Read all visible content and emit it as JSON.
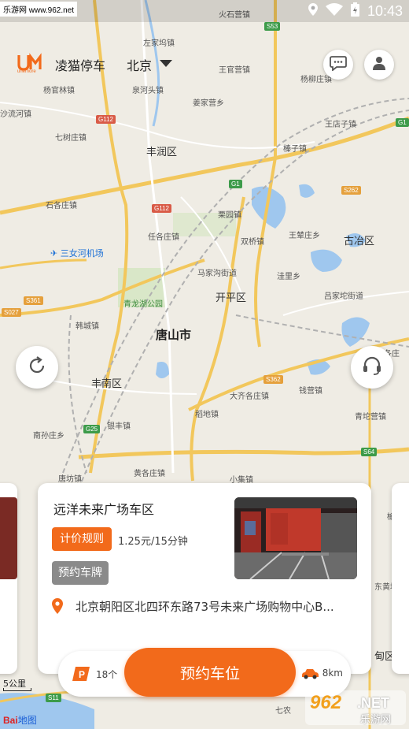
{
  "status_bar": {
    "watermark": "乐游网 www.962.net",
    "time": "10:43"
  },
  "header": {
    "logo_text": "unemore",
    "brand": "凌猫停车",
    "city": "北京"
  },
  "map": {
    "places": [
      {
        "label": "火石营镇",
        "size": "small"
      },
      {
        "label": "左家坞镇",
        "size": "small"
      },
      {
        "label": "王官营镇",
        "size": "small"
      },
      {
        "label": "杨柳庄镇",
        "size": "small"
      },
      {
        "label": "杨官林镇",
        "size": "small"
      },
      {
        "label": "泉河头镇",
        "size": "small"
      },
      {
        "label": "姜家营乡",
        "size": "small"
      },
      {
        "label": "沙流河镇",
        "size": "small"
      },
      {
        "label": "七树庄镇",
        "size": "small"
      },
      {
        "label": "王店子镇",
        "size": "small"
      },
      {
        "label": "丰润区",
        "size": "medium"
      },
      {
        "label": "榛子镇",
        "size": "small"
      },
      {
        "label": "石各庄镇",
        "size": "small"
      },
      {
        "label": "栗园镇",
        "size": "small"
      },
      {
        "label": "任各庄镇",
        "size": "small"
      },
      {
        "label": "王辇庄乡",
        "size": "small"
      },
      {
        "label": "古冶区",
        "size": "medium"
      },
      {
        "label": "双桥镇",
        "size": "small"
      },
      {
        "label": "三女河机场",
        "size": "airport"
      },
      {
        "label": "马家沟街道",
        "size": "small"
      },
      {
        "label": "洼里乡",
        "size": "small"
      },
      {
        "label": "开平区",
        "size": "medium"
      },
      {
        "label": "吕家坨街道",
        "size": "small"
      },
      {
        "label": "青龙湖公园",
        "size": "park"
      },
      {
        "label": "韩城镇",
        "size": "small"
      },
      {
        "label": "唐山市",
        "size": "big"
      },
      {
        "label": "范各庄",
        "size": "small"
      },
      {
        "label": "丰南区",
        "size": "medium"
      },
      {
        "label": "大齐各庄镇",
        "size": "small"
      },
      {
        "label": "钱营镇",
        "size": "small"
      },
      {
        "label": "稻地镇",
        "size": "small"
      },
      {
        "label": "青坨营镇",
        "size": "small"
      },
      {
        "label": "南孙庄乡",
        "size": "small"
      },
      {
        "label": "银丰镇",
        "size": "small"
      },
      {
        "label": "黄各庄镇",
        "size": "small"
      },
      {
        "label": "唐坊镇",
        "size": "small"
      },
      {
        "label": "小集镇",
        "size": "small"
      },
      {
        "label": "东黄坨镇",
        "size": "small"
      },
      {
        "label": "甸区",
        "size": "medium"
      },
      {
        "label": "榆坨镇",
        "size": "small"
      },
      {
        "label": "七农",
        "size": "small"
      },
      {
        "label": "镇",
        "size": "small"
      }
    ],
    "road_badges": [
      "S53",
      "G112",
      "G1",
      "S262",
      "G112",
      "S027",
      "S361",
      "S362",
      "G25",
      "S64",
      "S11",
      "G1"
    ],
    "scale": "5公里",
    "provider": "Bai",
    "provider_sub": "地图"
  },
  "card": {
    "title": "远洋未来广场车区",
    "price_tag": "计价规则",
    "price_text": "1.25元/15分钟",
    "plate_tag": "预约车牌",
    "address": "北京朝阳区北四环东路73号未来广场购物中心B..."
  },
  "bottom": {
    "count": "18个",
    "reserve": "预约车位",
    "distance": "8km"
  },
  "site_logo": {
    "number": "962",
    "net": ".NET",
    "name": "乐游网"
  },
  "colors": {
    "accent": "#f26a1b",
    "gray_tag": "#8a8a8a"
  }
}
